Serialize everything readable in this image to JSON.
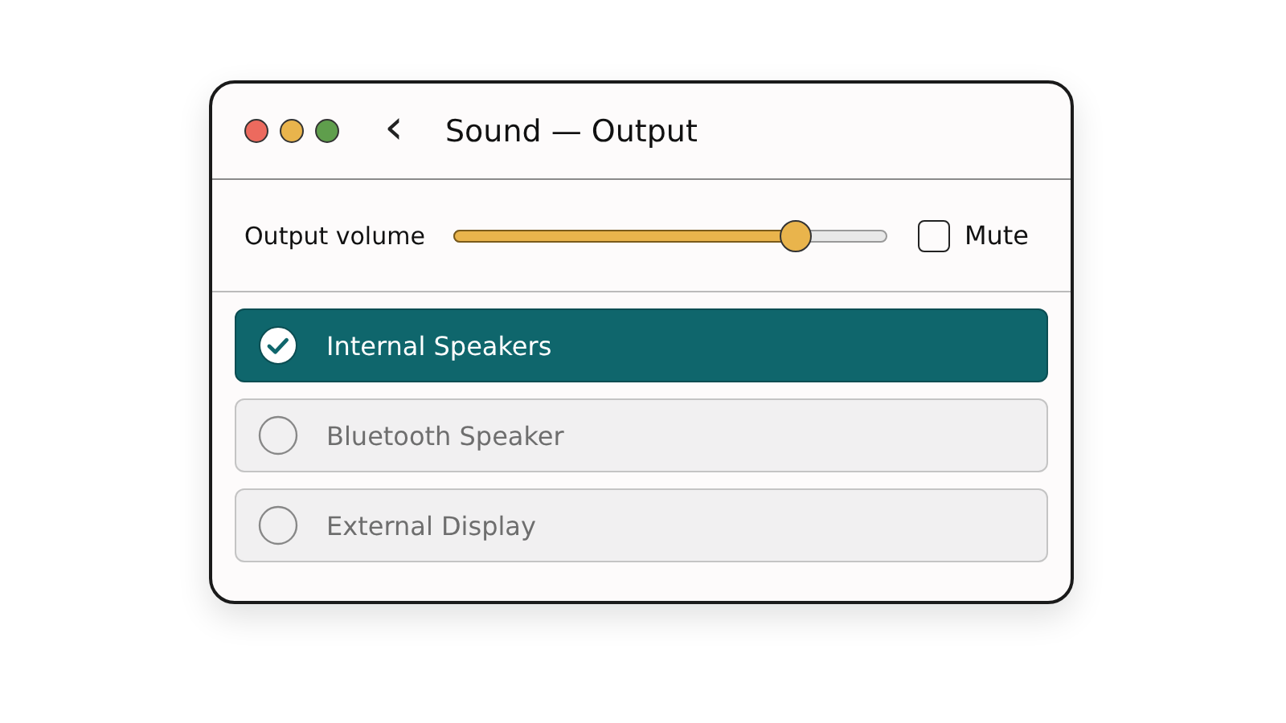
{
  "window": {
    "title": "Sound — Output",
    "back": "‹"
  },
  "volume": {
    "label": "Output volume",
    "level": 0.79,
    "mute": {
      "label": "Mute",
      "checked": false
    }
  },
  "devices": [
    {
      "name": "Internal Speakers",
      "selected": true
    },
    {
      "name": "Bluetooth Speaker",
      "selected": false
    },
    {
      "name": "External Display",
      "selected": false
    }
  ]
}
